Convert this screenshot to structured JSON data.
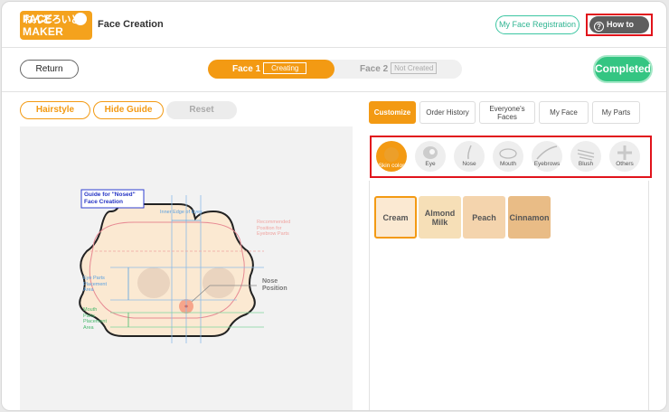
{
  "header": {
    "logo_jp": "ねんどろいど",
    "logo_en": "FACE MAKER",
    "title": "Face Creation",
    "my_face_registration": "My Face Registration",
    "how_to_use": "How to Use",
    "how_to_icon": "?"
  },
  "toolbar": {
    "return_label": "Return",
    "face1_label": "Face 1",
    "face1_status": "Creating",
    "face2_label": "Face 2",
    "face2_status": "Not Created",
    "completed_label": "Completed"
  },
  "left": {
    "hairstyle": "Hairstyle",
    "hide_guide": "Hide Guide",
    "reset": "Reset",
    "guide": {
      "title_line1": "Guide for \"Nosed\"",
      "title_line2": "Face Creation",
      "inner_edge": "Inner Edge of Eyes",
      "rec_line1": "Recommended",
      "rec_line2": "Position for",
      "rec_line3": "Eyebrow Parts",
      "eye_line1": "Eye Parts",
      "eye_line2": "Placement",
      "eye_line3": "Area",
      "nose_line1": "Nose",
      "nose_line2": "Position",
      "mouth_line1": "Mouth",
      "mouth_line2": "Parts",
      "mouth_line3": "Placement",
      "mouth_line4": "Area"
    }
  },
  "right": {
    "tabs": [
      {
        "label": "Customize",
        "active": true
      },
      {
        "label": "Order History",
        "active": false
      },
      {
        "label": "Everyone's Faces",
        "active": false
      },
      {
        "label": "My Face",
        "active": false
      },
      {
        "label": "My Parts",
        "active": false
      }
    ],
    "parts": [
      {
        "label": "Skin color",
        "icon": "skin-color-icon",
        "active": true
      },
      {
        "label": "Eye",
        "icon": "eye-icon",
        "active": false
      },
      {
        "label": "Nose",
        "icon": "nose-icon",
        "active": false
      },
      {
        "label": "Mouth",
        "icon": "mouth-icon",
        "active": false
      },
      {
        "label": "Eyebrows",
        "icon": "eyebrows-icon",
        "active": false
      },
      {
        "label": "Blush",
        "icon": "blush-icon",
        "active": false
      },
      {
        "label": "Others",
        "icon": "plus-icon",
        "active": false
      }
    ],
    "skin_colors": [
      {
        "label": "Cream",
        "color": "#fbe9d2",
        "selected": true
      },
      {
        "label": "Almond Milk",
        "color": "#f6dfb7",
        "selected": false
      },
      {
        "label": "Peach",
        "color": "#f4d4ad",
        "selected": false
      },
      {
        "label": "Cinnamon",
        "color": "#e9bc86",
        "selected": false
      }
    ]
  },
  "colors": {
    "accent": "#f39a13",
    "completed": "#34c582",
    "registration": "#3cc6a2",
    "highlight": "#e1131b"
  }
}
